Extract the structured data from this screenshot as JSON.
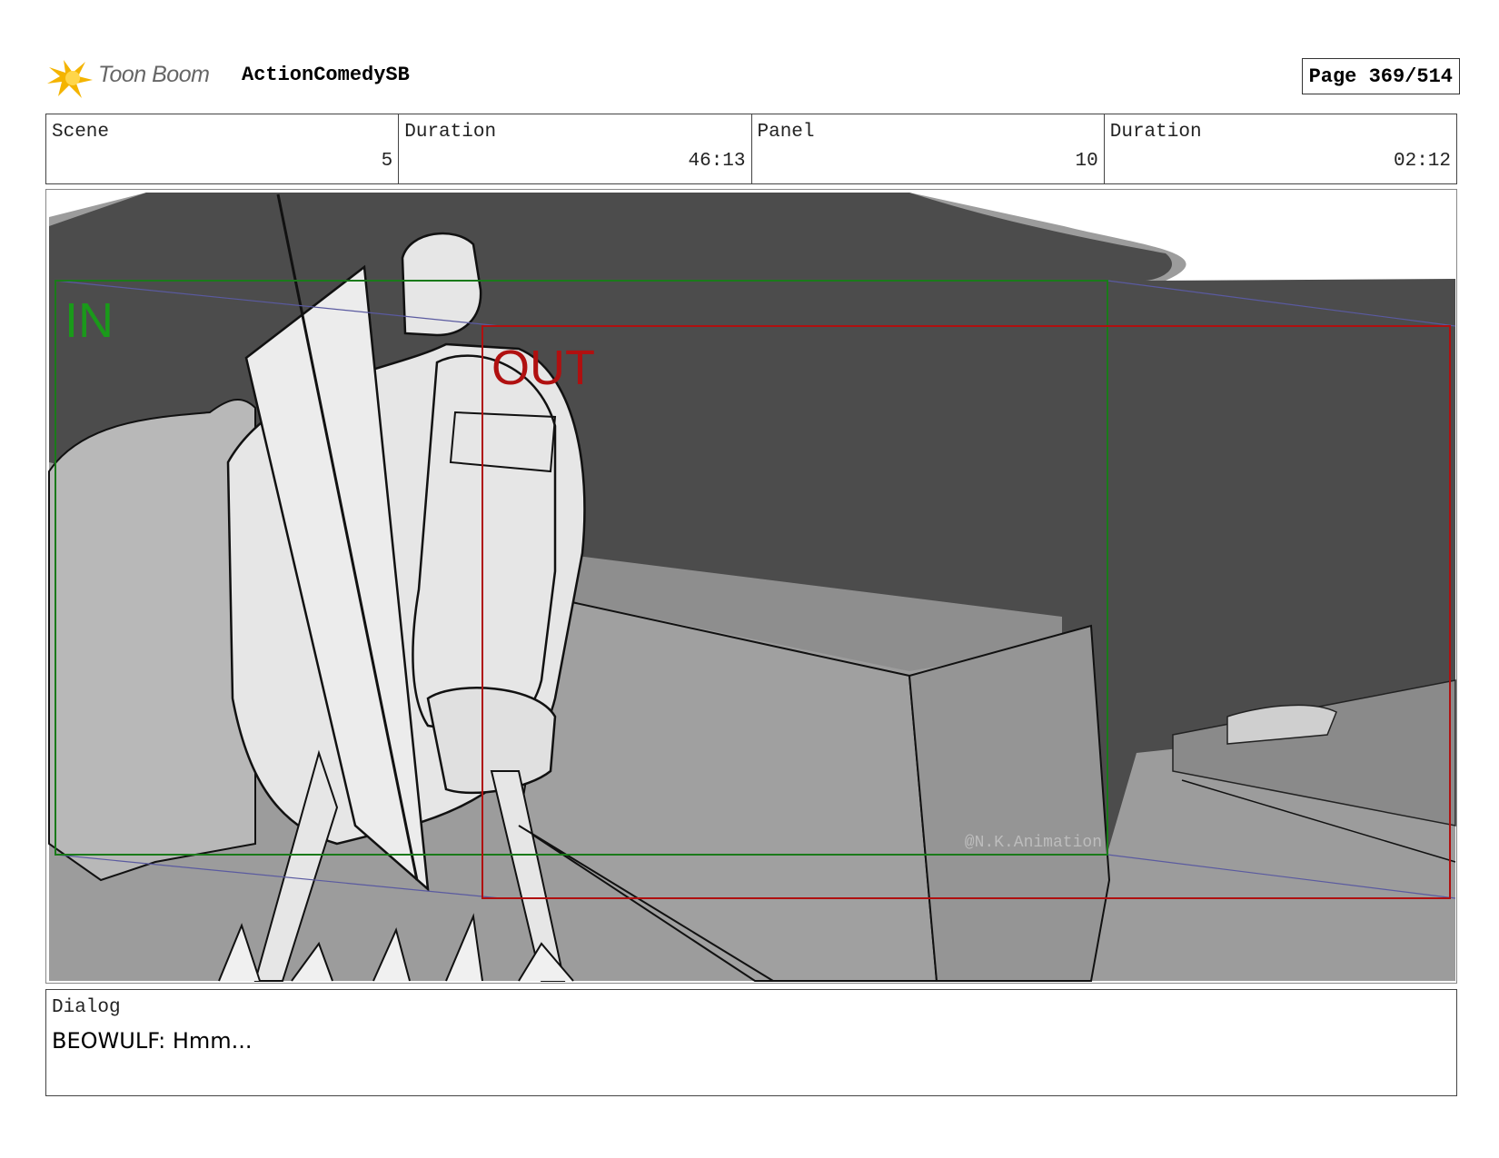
{
  "header": {
    "brand": "Toon Boom",
    "project": "ActionComedySB",
    "page": "Page 369/514"
  },
  "info": {
    "scene_label": "Scene",
    "scene_value": "5",
    "scene_duration_label": "Duration",
    "scene_duration_value": "46:13",
    "panel_label": "Panel",
    "panel_value": "10",
    "panel_duration_label": "Duration",
    "panel_duration_value": "02:12"
  },
  "frame": {
    "in_label": "IN",
    "out_label": "OUT",
    "watermark": "@N.K.Animation",
    "colors": {
      "in": "#1a7a1a",
      "out": "#b01010",
      "guide": "#5a5aa0"
    }
  },
  "dialog": {
    "label": "Dialog",
    "text": "BEOWULF: Hmm..."
  }
}
